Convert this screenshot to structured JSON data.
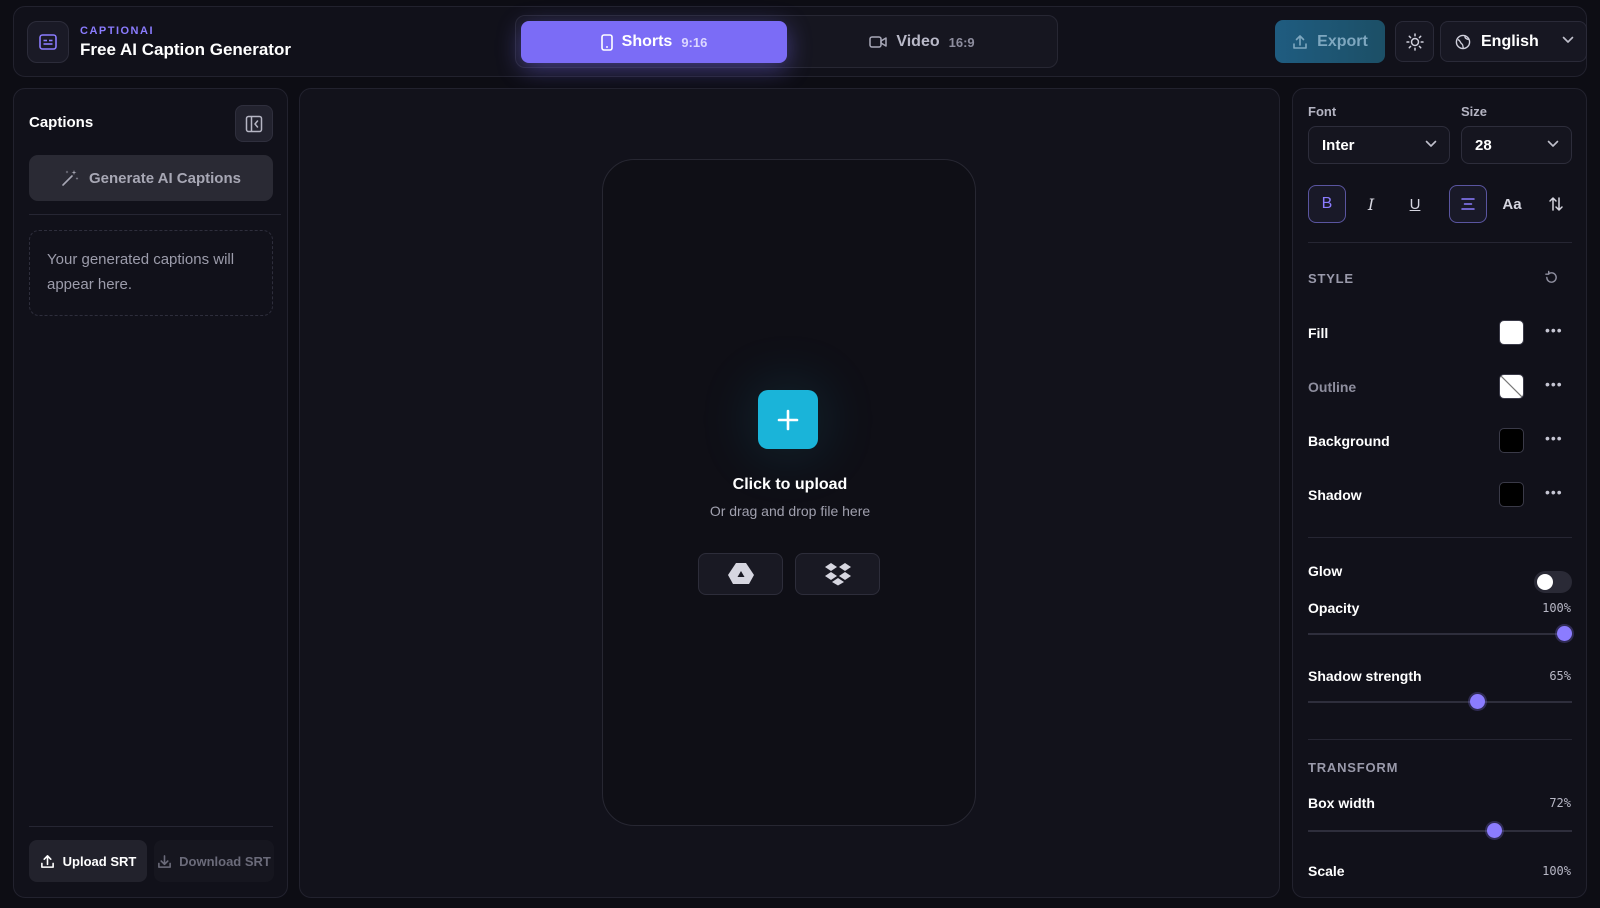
{
  "header": {
    "kicker": "CAPTIONAI",
    "title": "Free AI Caption Generator",
    "modes": [
      {
        "label": "Shorts",
        "ratio": "9:16"
      },
      {
        "label": "Video",
        "ratio": "16:9"
      }
    ],
    "export_label": "Export",
    "language": "English",
    "icons": {
      "brand": "captions-icon",
      "theme": "sun-icon",
      "language": "globe-icon"
    }
  },
  "left": {
    "title": "Captions",
    "generate_label": "Generate AI Captions",
    "empty_text": "Your generated captions will appear here.",
    "upload_srt": "Upload SRT",
    "download_srt": "Download SRT"
  },
  "center": {
    "upload_title": "Click to upload",
    "upload_subtitle": "Or drag and drop file here",
    "sources": [
      "google-drive-icon",
      "dropbox-icon"
    ]
  },
  "right": {
    "font_label": "Font",
    "font_value": "Inter",
    "size_label": "Size",
    "size_value": "28",
    "format": {
      "bold": "B",
      "italic": "I",
      "underline": "U",
      "case": "Aa"
    },
    "style_title": "STYLE",
    "fill_label": "Fill",
    "fill_color": "#ffffff",
    "outline_label": "Outline",
    "background_label": "Background",
    "background_color": "#000000",
    "shadow_label": "Shadow",
    "shadow_color": "#000000",
    "glow_label": "Glow",
    "glow_on": false,
    "opacity_label": "Opacity",
    "opacity_value": "100%",
    "opacity_fraction": 1.0,
    "shadow_strength_label": "Shadow strength",
    "shadow_strength_value": "65%",
    "shadow_strength_fraction": 0.65,
    "transform_title": "TRANSFORM",
    "box_width_label": "Box width",
    "box_width_value": "72%",
    "box_width_fraction": 0.72,
    "scale_label": "Scale",
    "scale_value": "100%"
  },
  "colors": {
    "accent": "#7b6cf6",
    "upload": "#1ab4d9",
    "export": "#1f5c80"
  }
}
